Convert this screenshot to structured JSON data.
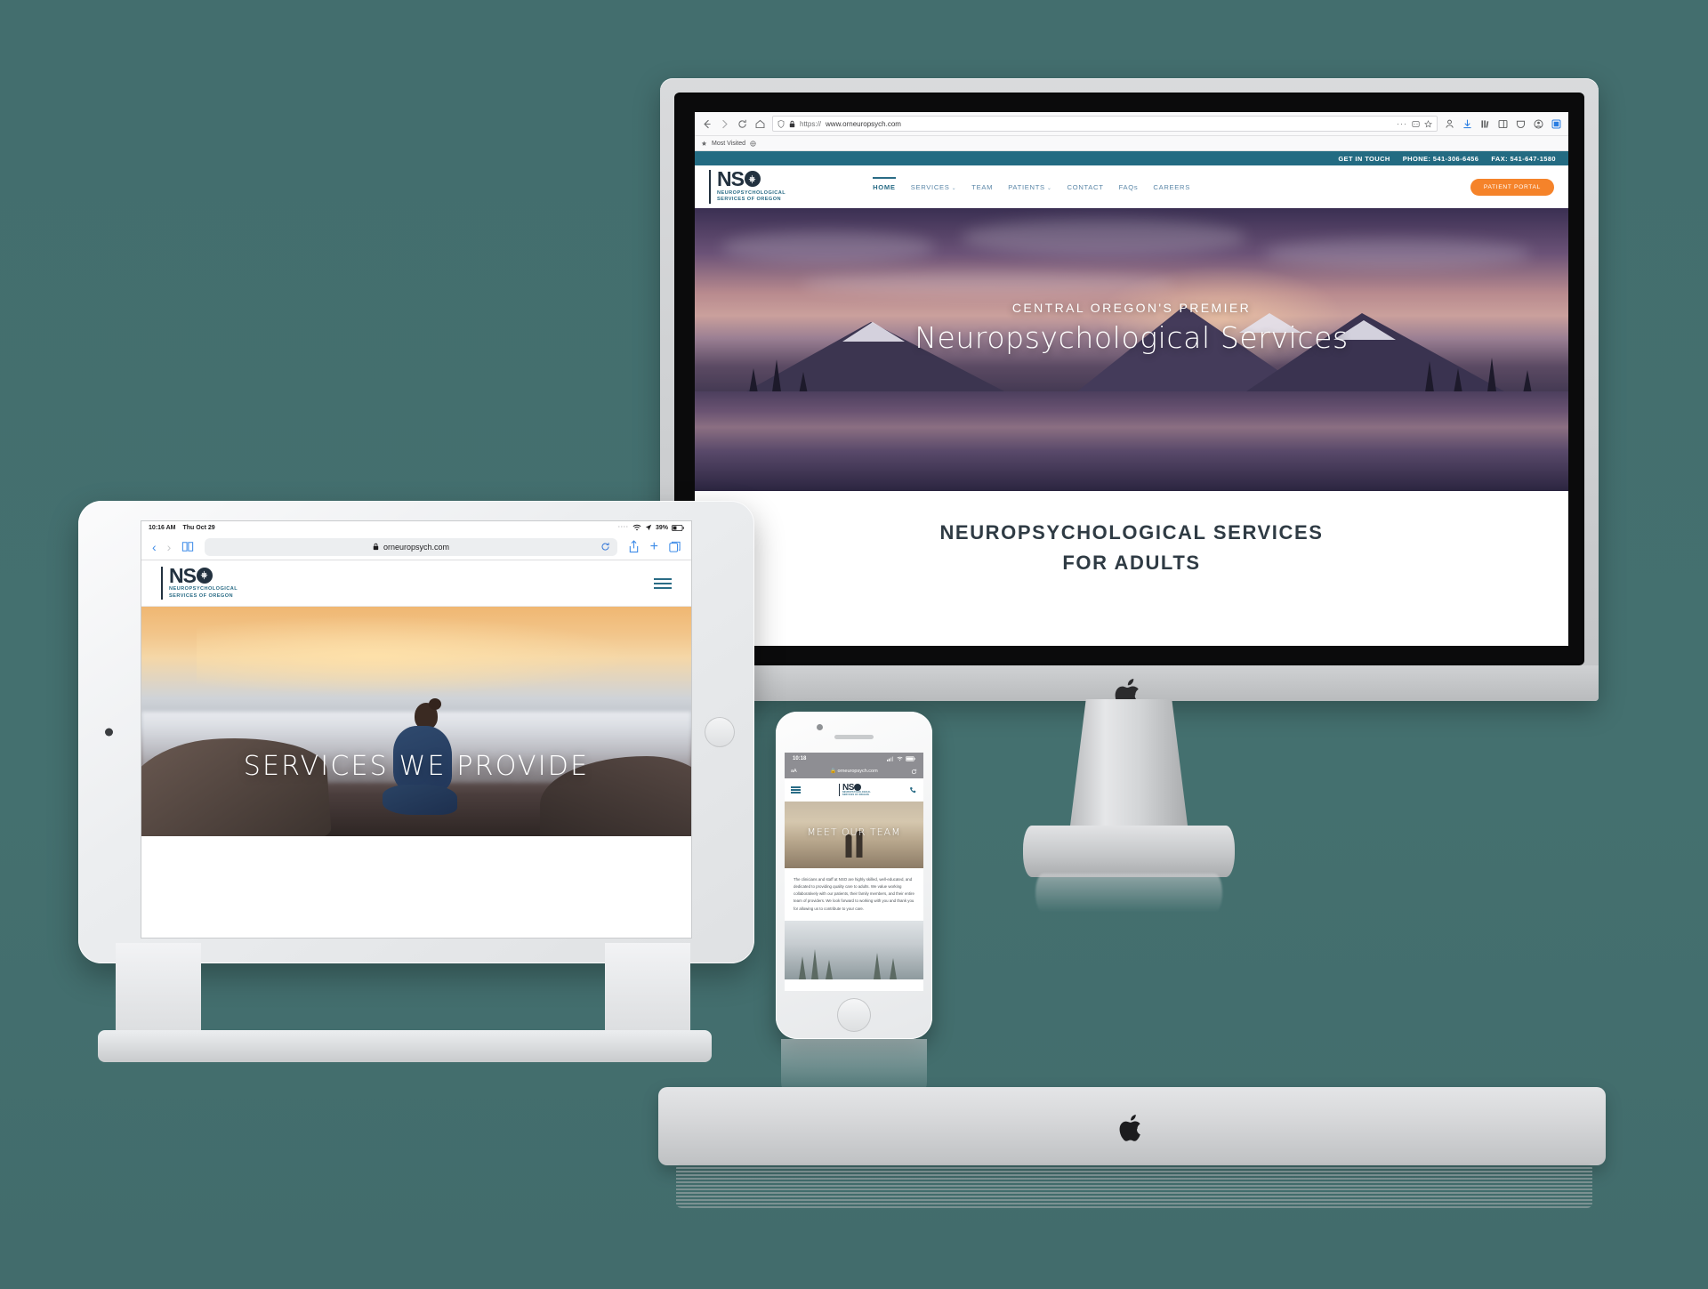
{
  "scene": {
    "background_color": "#436e6e",
    "devices": [
      "imac",
      "ipad",
      "iphone",
      "apple-keyboard"
    ]
  },
  "desktop": {
    "browser": {
      "name": "Firefox",
      "url_protocol": "https://",
      "url": "www.orneuropsych.com",
      "bookmark_label": "Most Visited",
      "toolbar_icons": [
        "back-arrow-icon",
        "forward-arrow-icon",
        "reload-icon",
        "home-icon",
        "shield-icon",
        "lock-icon",
        "ellipsis-icon",
        "reader-icon",
        "star-icon",
        "account-icon",
        "downloads-icon",
        "library-icon",
        "sidebar-icon",
        "pocket-icon",
        "profile-icon",
        "menu-icon"
      ]
    },
    "topbar": {
      "get_in_touch": "GET IN TOUCH",
      "phone": "PHONE: 541-306-6456",
      "fax": "FAX: 541-647-1580",
      "bg_color": "#236b82"
    },
    "logo": {
      "mark": "NS",
      "sub_line1": "NEUROPSYCHOLOGICAL",
      "sub_line2": "SERVICES OF OREGON",
      "dark_color": "#22313f",
      "accent_color": "#2a6c86"
    },
    "nav": [
      {
        "label": "HOME",
        "active": true,
        "dropdown": false
      },
      {
        "label": "SERVICES",
        "active": false,
        "dropdown": true
      },
      {
        "label": "TEAM",
        "active": false,
        "dropdown": false
      },
      {
        "label": "PATIENTS",
        "active": false,
        "dropdown": true
      },
      {
        "label": "CONTACT",
        "active": false,
        "dropdown": false
      },
      {
        "label": "FAQs",
        "active": false,
        "dropdown": false
      },
      {
        "label": "CAREERS",
        "active": false,
        "dropdown": false
      }
    ],
    "portal_button": {
      "label": "PATIENT PORTAL",
      "color": "#f5832a"
    },
    "hero": {
      "kicker": "CENTRAL OREGON'S PREMIER",
      "title": "Neuropsychological Services",
      "image_description": "mountain lake at dusk with purple sky and reflection"
    },
    "section": {
      "line1": "NEUROPSYCHOLOGICAL SERVICES",
      "line2": "FOR ADULTS"
    }
  },
  "tablet": {
    "status": {
      "time": "10:16 AM",
      "date": "Thu Oct 29",
      "battery": "39%",
      "wifi": "wifi-icon",
      "location": "location-arrow-icon"
    },
    "browser": {
      "url": "orneuropsych.com",
      "lock": "lock-icon",
      "icons": [
        "back-chevron-icon",
        "forward-chevron-icon",
        "bookmarks-icon",
        "reload-icon",
        "share-icon",
        "new-tab-icon",
        "tabs-icon"
      ]
    },
    "logo": {
      "mark": "NS",
      "sub_line1": "NEUROPSYCHOLOGICAL",
      "sub_line2": "SERVICES OF OREGON"
    },
    "menu_icon": "hamburger-menu-icon",
    "hero": {
      "title": "SERVICES WE PROVIDE",
      "image_description": "woman meditating on cliff above clouds at sunset"
    }
  },
  "phone": {
    "status": {
      "time": "10:18",
      "signal": "cellular-signal-icon",
      "wifi": "wifi-icon",
      "battery": "battery-icon"
    },
    "browser": {
      "text_size_label": "aA",
      "url": "orneuropsych.com",
      "lock": "lock-icon",
      "reload": "reload-icon"
    },
    "logo": {
      "mark": "NS",
      "sub_line1": "NEUROPSYCHOLOGICAL",
      "sub_line2": "SERVICES OF OREGON"
    },
    "menu_icon": "hamburger-menu-icon",
    "call_icon": "phone-icon",
    "hero": {
      "title": "MEET OUR TEAM",
      "image_description": "two people with arms raised outdoors"
    },
    "body_text": "The clinicians and staff at NSO are highly skilled, well-educated, and dedicated to providing quality care to adults. We value working collaboratively with our patients, their family members, and their entire team of providers. We look forward to working with you and thank you for allowing us to contribute to your care."
  }
}
